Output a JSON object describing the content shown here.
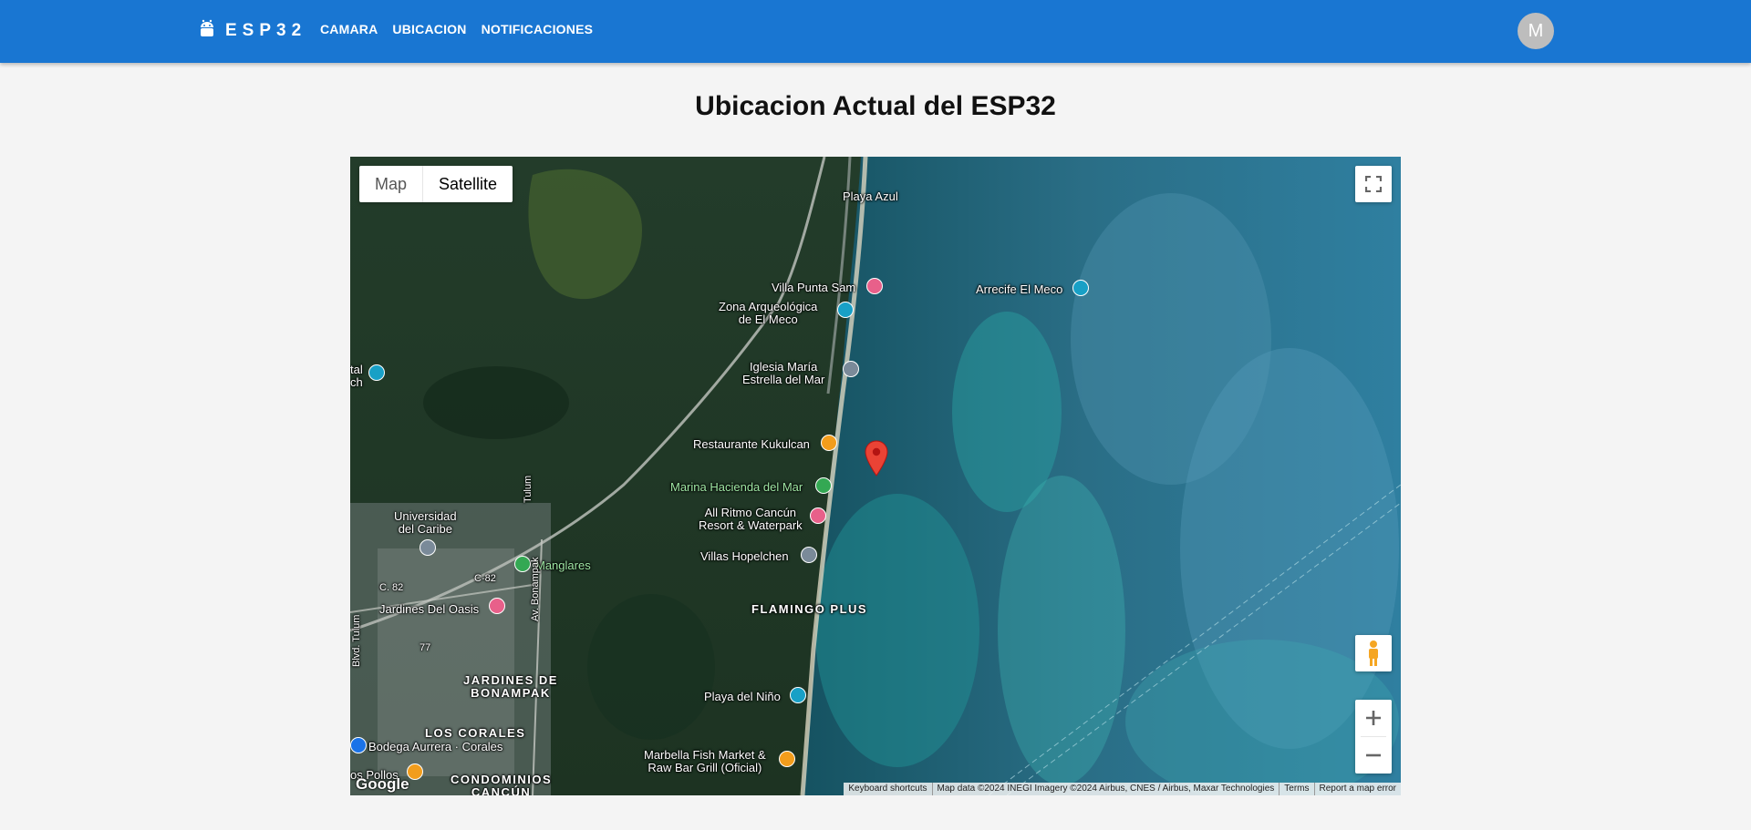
{
  "header": {
    "brand": "ESP32",
    "nav": [
      "CAMARA",
      "UBICACION",
      "NOTIFICACIONES"
    ],
    "avatar_initial": "M"
  },
  "page": {
    "title": "Ubicacion Actual del ESP32"
  },
  "map": {
    "map_type": {
      "map_label": "Map",
      "satellite_label": "Satellite",
      "selected": "Satellite"
    },
    "labels": {
      "playa_azul": "Playa Azul",
      "villa_punta_sam": "Villa Punta Sam",
      "arrecife": "Arrecife El Meco",
      "zona_arq_1": "Zona Arqueológica",
      "zona_arq_2": "de El Meco",
      "iglesia_1": "Iglesia María",
      "iglesia_2": "Estrella del Mar",
      "tal": "tal",
      "ch": "ch",
      "restaurante": "Restaurante Kukulcan",
      "marina": "Marina Hacienda del Mar",
      "ritmo_1": "All Ritmo Cancún",
      "ritmo_2": "Resort & Waterpark",
      "villas": "Villas Hopelchen",
      "universidad_1": "Universidad",
      "universidad_2": "del Caribe",
      "manglares": "Manglares",
      "c82a": "C. 82",
      "c82b": "C-82",
      "jardines_oasis": "Jardines Del Oasis",
      "flamingo": "FLAMINGO PLUS",
      "tulum": "Tulum",
      "bonampak": "Av. Bonampak",
      "n77": "77",
      "jardines_bonampak_1": "JARDINES DE",
      "jardines_bonampak_2": "BONAMPAK",
      "playa_nino": "Playa del Niño",
      "los_corales": "LOS CORALES",
      "bodega": "Bodega Aurrera · Corales",
      "marbella_1": "Marbella Fish Market &",
      "marbella_2": "Raw Bar Grill (Oficial)",
      "pollos": "os Pollos",
      "condominios_1": "CONDOMINIOS",
      "condominios_2": "CANCÚN",
      "blvd_tulum": "Blvd. Tulum"
    },
    "google_logo": "Google",
    "attribution": {
      "shortcuts": "Keyboard shortcuts",
      "data": "Map data ©2024 INEGI Imagery ©2024 Airbus, CNES / Airbus, Maxar Technologies",
      "terms": "Terms",
      "report": "Report a map error"
    },
    "colors": {
      "ocean_deep": "#0d3f4a",
      "ocean_reef": "#2aa3a3",
      "land": "#1f3b2a",
      "marker": "#ea4335",
      "poi_blue": "#18a0c6",
      "poi_pink": "#e8608a",
      "poi_orange": "#f29d1c",
      "poi_green": "#34a853",
      "poi_gray": "#7a8a99"
    },
    "icons": [
      "camera-icon",
      "fullscreen-icon",
      "pegman-icon",
      "zoom-in-icon",
      "zoom-out-icon",
      "map-marker-icon"
    ]
  },
  "theme": {
    "appbar": "#1976d2",
    "avatar_bg": "#bdbdbd",
    "background": "#f4f4f4"
  }
}
